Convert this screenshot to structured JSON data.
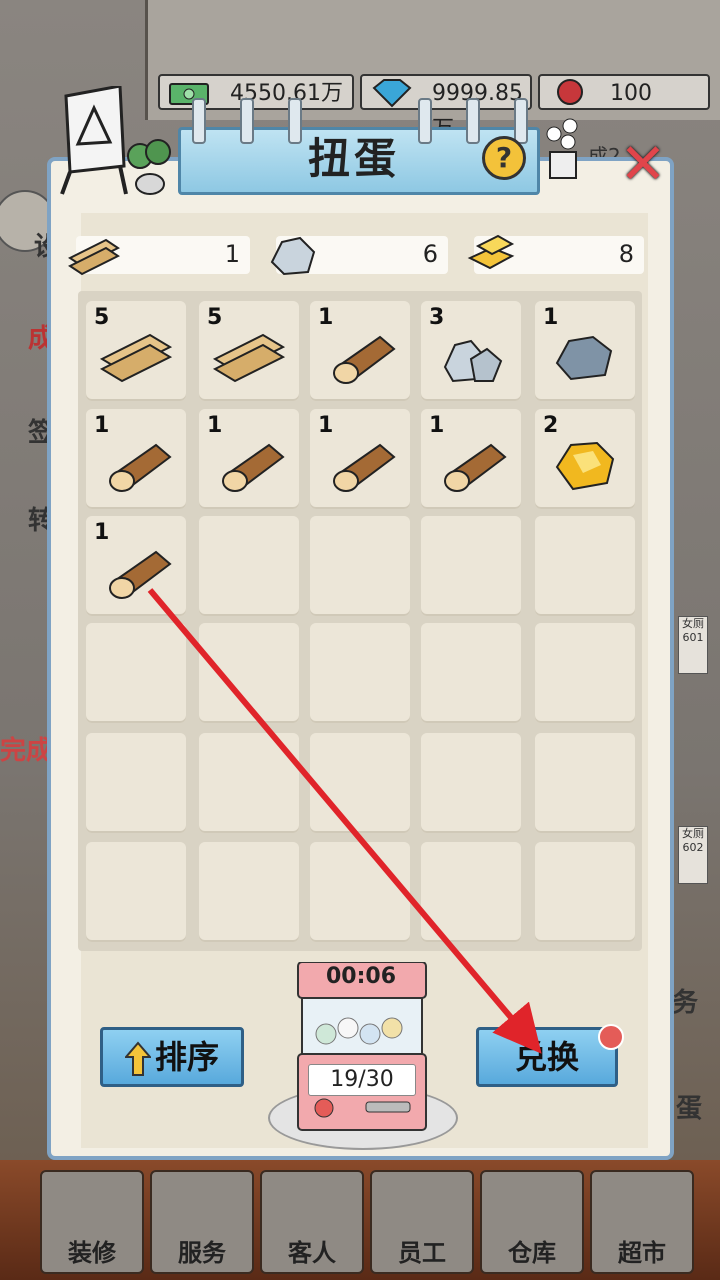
{
  "background": {
    "resources": [
      {
        "icon": "cash-icon",
        "value": "4550.61万"
      },
      {
        "icon": "diamond-icon",
        "value": "9999.85万"
      },
      {
        "icon": "rose-icon",
        "value": "100"
      }
    ],
    "side_labels": [
      "设",
      "成",
      "签",
      "转",
      "完成",
      "务",
      "蛋"
    ],
    "right_tags": [
      "女厕\n601",
      "女厕\n602"
    ],
    "partial_label": "成2"
  },
  "modal": {
    "title": "扭蛋",
    "help_label": "?",
    "close_label": "✕",
    "materials": [
      {
        "icon": "plank-icon",
        "count": "1"
      },
      {
        "icon": "stone-icon",
        "count": "6"
      },
      {
        "icon": "gold-bar-icon",
        "count": "8"
      }
    ],
    "grid": [
      {
        "icon": "plank-icon",
        "count": "5"
      },
      {
        "icon": "plank-icon",
        "count": "5"
      },
      {
        "icon": "log-icon",
        "count": "1"
      },
      {
        "icon": "stone-pile-icon",
        "count": "3"
      },
      {
        "icon": "rock-icon",
        "count": "1"
      },
      {
        "icon": "log-icon",
        "count": "1"
      },
      {
        "icon": "log-icon",
        "count": "1"
      },
      {
        "icon": "log-icon",
        "count": "1"
      },
      {
        "icon": "log-icon",
        "count": "1"
      },
      {
        "icon": "gold-ore-icon",
        "count": "2"
      },
      {
        "icon": "log-icon",
        "count": "1"
      }
    ],
    "sort_button": "排序",
    "exchange_button": "兑换",
    "machine": {
      "timer": "00:06",
      "capacity": "19/30"
    }
  },
  "bottom_nav": [
    "装修",
    "服务",
    "客人",
    "员工",
    "仓库",
    "超市"
  ]
}
